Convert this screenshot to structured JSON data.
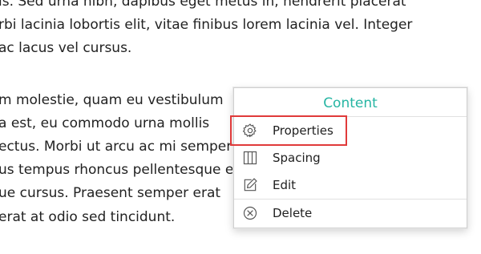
{
  "document": {
    "lines_top": [
      "is. Sed urna nibh, dapibus eget metus in, hendrerit placerat",
      "rbi lacinia lobortis elit, vitae finibus lorem lacinia vel. Integer",
      "ac lacus vel cursus."
    ],
    "lines_bottom": [
      "m molestie, quam eu vestibulum",
      "a est, eu commodo urna mollis",
      "ectus. Morbi ut arcu ac mi semper",
      "us tempus rhoncus pellentesque es",
      "ue cursus. Praesent semper erat",
      "erat at odio sed tincidunt."
    ]
  },
  "context_menu": {
    "title": "Content",
    "title_color": "#26b5a3",
    "highlight_color": "#e03a3a",
    "items": [
      {
        "label": "Properties",
        "icon": "gear-icon",
        "highlighted": true
      },
      {
        "label": "Spacing",
        "icon": "columns-icon",
        "highlighted": false
      },
      {
        "label": "Edit",
        "icon": "edit-icon",
        "highlighted": false
      },
      {
        "label": "Delete",
        "icon": "delete-icon",
        "highlighted": false
      }
    ]
  }
}
